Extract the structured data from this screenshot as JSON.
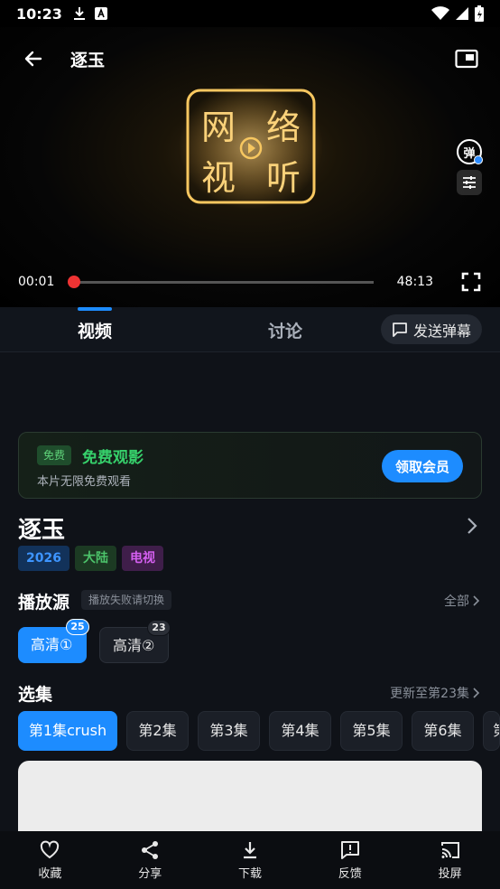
{
  "status_bar": {
    "time": "10:23"
  },
  "player": {
    "title": "逐玉",
    "logo_text": [
      "网",
      "络",
      "视",
      "听"
    ],
    "danmu_toggle": "弹",
    "current_time": "00:01",
    "duration": "48:13",
    "progress_fraction": 0.0
  },
  "tabs": {
    "video": "视频",
    "discuss": "讨论",
    "send_danmu": "发送弹幕"
  },
  "vip": {
    "badge": "免费",
    "title": "免费观影",
    "subtitle": "本片无限免费观看",
    "button": "领取会员"
  },
  "show": {
    "title": "逐玉",
    "tags": [
      "2026",
      "大陆",
      "电视"
    ]
  },
  "source": {
    "heading": "播放源",
    "hint": "播放失败请切换",
    "all": "全部",
    "options": [
      {
        "label": "高清①",
        "count": "25"
      },
      {
        "label": "高清②",
        "count": "23"
      }
    ]
  },
  "episodes": {
    "heading": "选集",
    "update": "更新至第23集",
    "items": [
      "第1集crush",
      "第2集",
      "第3集",
      "第4集",
      "第5集",
      "第6集",
      "第"
    ]
  },
  "bottom_bar": [
    "收藏",
    "分享",
    "下载",
    "反馈",
    "投屏"
  ],
  "colors": {
    "accent": "#1d8cff",
    "free_green": "#36d06b",
    "progress_red": "#e33333"
  }
}
